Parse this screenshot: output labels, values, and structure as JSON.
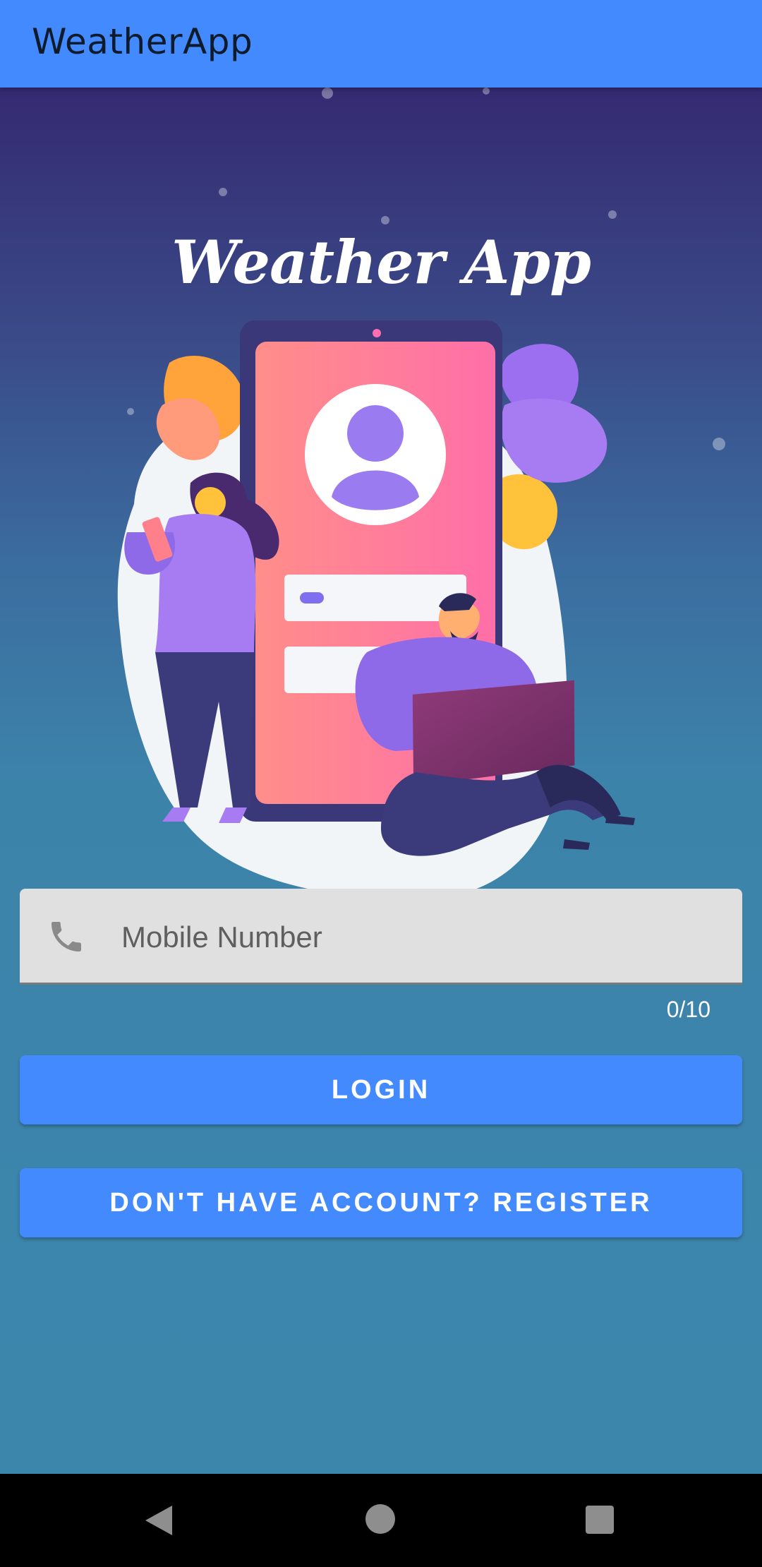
{
  "appbar": {
    "title": "WeatherApp"
  },
  "hero": {
    "title": "Weather App"
  },
  "login_form": {
    "phone_icon": "phone-icon",
    "mobile_placeholder": "Mobile Number",
    "mobile_value": "",
    "counter": "0/10",
    "login_label": "LOGIN",
    "register_label": "DON'T HAVE ACCOUNT? REGISTER"
  },
  "nav": {
    "back_icon": "back-triangle-icon",
    "home_icon": "home-circle-icon",
    "recents_icon": "recents-square-icon"
  },
  "colors": {
    "primary": "#448aff",
    "background_bottom": "#3c86ac",
    "background_top": "#352a72"
  }
}
